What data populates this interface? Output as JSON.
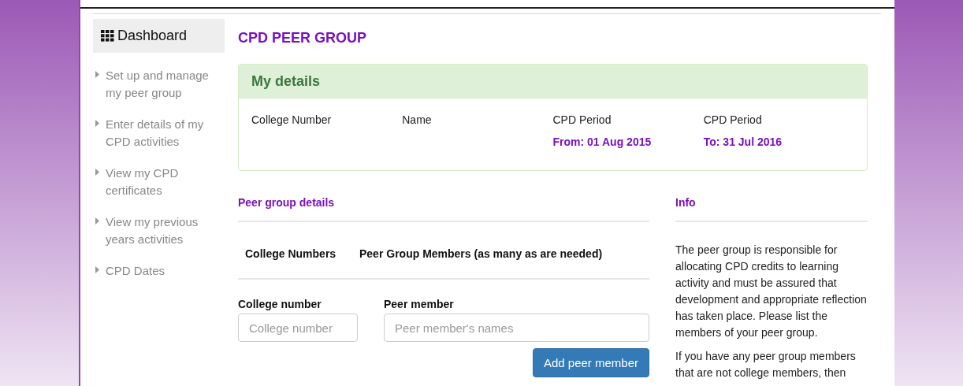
{
  "sidebar": {
    "title": "Dashboard",
    "items": [
      {
        "label": "Set up and manage my peer group"
      },
      {
        "label": "Enter details of my CPD activities"
      },
      {
        "label": "View my CPD certificates"
      },
      {
        "label": "View my previous years activities"
      },
      {
        "label": "CPD Dates"
      }
    ]
  },
  "page_title": "CPD PEER GROUP",
  "my_details": {
    "title": "My details",
    "columns": [
      {
        "label": "College Number"
      },
      {
        "label": "Name"
      },
      {
        "label": "CPD Period",
        "value": "From: 01 Aug 2015"
      },
      {
        "label": "CPD Period",
        "value": "To: 31 Jul 2016"
      }
    ]
  },
  "peer_group": {
    "title": "Peer group details",
    "headers": [
      "College Numbers",
      "Peer Group Members (as many as are needed)"
    ],
    "college_field": {
      "label": "College number",
      "placeholder": "College number"
    },
    "member_field": {
      "label": "Peer member",
      "placeholder": "Peer member's names"
    },
    "button": "Add peer member"
  },
  "info": {
    "title": "Info",
    "paragraphs": [
      "The peer group is responsible for allocating CPD credits to learning activity and must be assured that development and appropriate reflection has taken place. Please list the members of your peer group.",
      "If you have any peer group members that are not college members, then"
    ]
  }
}
